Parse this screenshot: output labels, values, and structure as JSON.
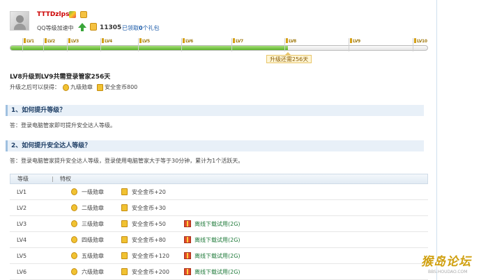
{
  "user": {
    "name": "TTTDzlps.",
    "accel_label": "QQ等级加速中",
    "score": "11305",
    "gift_prefix": "已领取",
    "gift_count": "0",
    "gift_suffix": "个礼包"
  },
  "progress": {
    "marks": [
      "LV1",
      "LV2",
      "LV3",
      "LV4",
      "LV5",
      "LV6",
      "LV7",
      "LV8",
      "LV9",
      "LV10"
    ],
    "fill_fraction": 0.665,
    "tooltip": "升级还需256天"
  },
  "info": {
    "title": "LV8升级到LV9共需登录管家256天",
    "reward_label": "升级之后可以获得：",
    "reward_medal": "九级勋章",
    "reward_coin": "安全金币800"
  },
  "sections": [
    {
      "heading": "1、如何提升等级？",
      "answer": "答：登录电脑管家即可提升安全达人等级。"
    },
    {
      "heading": "2、如何提升安全达人等级？",
      "answer": "答：登录电脑管家提升安全达人等级，登录使用电脑管家大于等于30分钟，累计为1个活跃天。"
    }
  ],
  "table": {
    "headers": [
      "等级",
      "特权"
    ],
    "rows": [
      {
        "level": "LV1",
        "medal": "一级勋章",
        "coin": "安全金币+20",
        "download": ""
      },
      {
        "level": "LV2",
        "medal": "二级勋章",
        "coin": "安全金币+30",
        "download": ""
      },
      {
        "level": "LV3",
        "medal": "三级勋章",
        "coin": "安全金币+50",
        "download": "离线下载试用(2G)"
      },
      {
        "level": "LV4",
        "medal": "四级勋章",
        "coin": "安全金币+80",
        "download": "离线下载试用(2G)"
      },
      {
        "level": "LV5",
        "medal": "五级勋章",
        "coin": "安全金币+120",
        "download": "离线下载试用(2G)"
      },
      {
        "level": "LV6",
        "medal": "六级勋章",
        "coin": "安全金币+200",
        "download": "离线下载试用(2G)"
      }
    ]
  },
  "watermark": {
    "main": "猴岛论坛",
    "sub": "BBS.HOUDAO.COM"
  }
}
